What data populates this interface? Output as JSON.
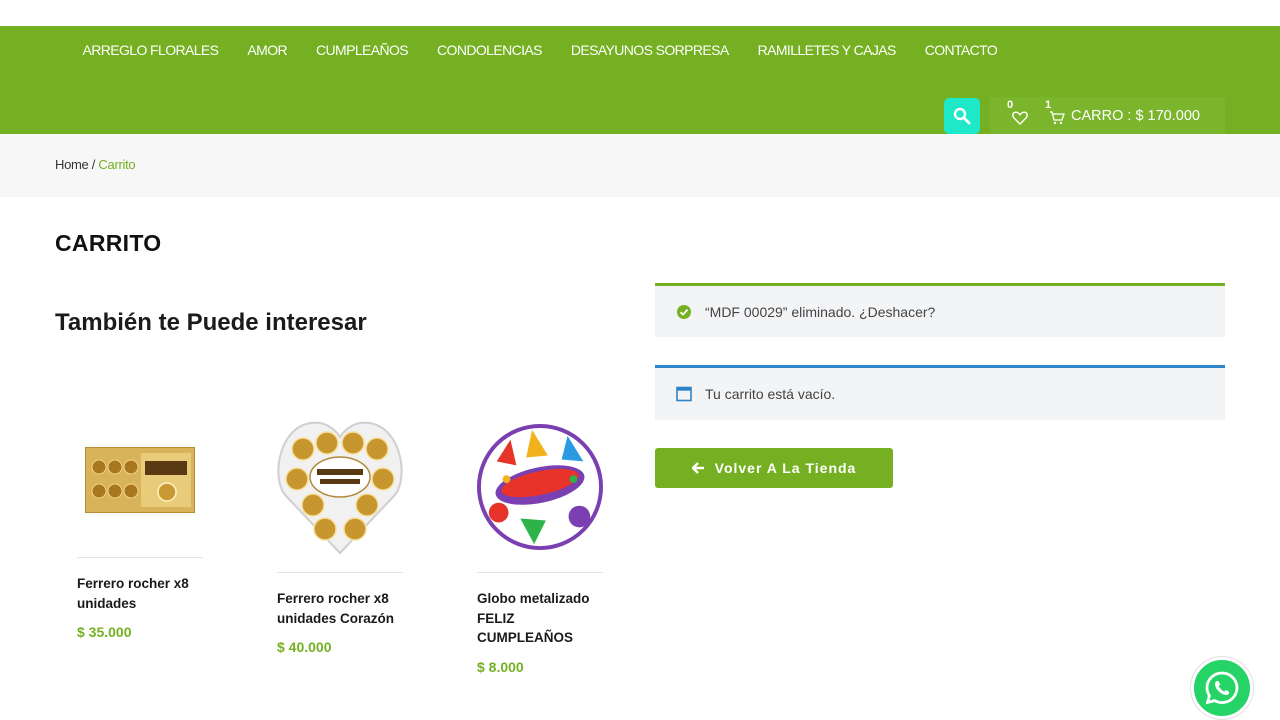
{
  "nav": {
    "items": [
      "ARREGLO FLORALES",
      "AMOR",
      "CUMPLEAÑOS",
      "CONDOLENCIAS",
      "DESAYUNOS SORPRESA",
      "RAMILLETES Y CAJAS",
      "CONTACTO"
    ]
  },
  "header": {
    "wishlist_count": "0",
    "cart_count": "1",
    "cart_label": "CARRO : $ 170.000",
    "search_icon": "search-icon",
    "wishlist_icon": "heart-icon",
    "cart_icon": "shopping-cart-icon"
  },
  "breadcrumb": {
    "home": "Home",
    "separator": " / ",
    "current": "Carrito"
  },
  "page": {
    "title": "CARRITO",
    "related_title": "También te Puede interesar"
  },
  "products": [
    {
      "name": "Ferrero rocher x8 unidades",
      "price": "$ 35.000"
    },
    {
      "name": "Ferrero rocher x8 unidades Corazón",
      "price": "$ 40.000"
    },
    {
      "name": "Globo metalizado FELIZ CUMPLEAÑOS",
      "price": "$ 8.000"
    }
  ],
  "notices": {
    "success": "“MDF 00029” eliminado. ¿Deshacer?",
    "empty": "Tu carrito está vacío."
  },
  "back_button": "Volver A La Tienda",
  "colors": {
    "brand": "#74b021",
    "search_button": "#1ee8c7",
    "info_border": "#2e84c8",
    "whatsapp": "#25d366"
  }
}
